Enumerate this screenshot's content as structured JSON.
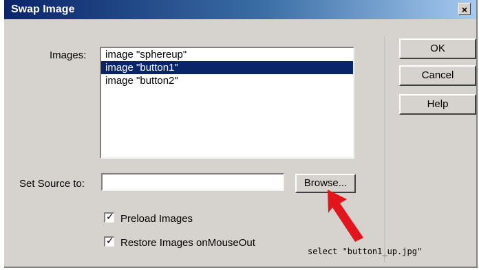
{
  "dialog": {
    "title": "Swap Image",
    "close_glyph": "×"
  },
  "images_section": {
    "label": "Images:",
    "items": [
      {
        "label": "image \"sphereup\"",
        "selected": false
      },
      {
        "label": "image \"button1\"",
        "selected": true
      },
      {
        "label": "image \"button2\"",
        "selected": false
      }
    ]
  },
  "source": {
    "label": "Set Source to:",
    "value": "",
    "browse_label": "Browse..."
  },
  "options": {
    "preload": {
      "label": "Preload Images",
      "checked": true
    },
    "restore": {
      "label": "Restore Images onMouseOut",
      "checked": true
    }
  },
  "buttons": {
    "ok": "OK",
    "cancel": "Cancel",
    "help": "Help"
  },
  "annotation": {
    "text": "select \"button1_up.jpg\"",
    "arrow_color": "#e3141b"
  },
  "colors": {
    "dialog_bg": "#d6d3ce",
    "selection": "#0a246a",
    "title_start": "#0b246a"
  }
}
